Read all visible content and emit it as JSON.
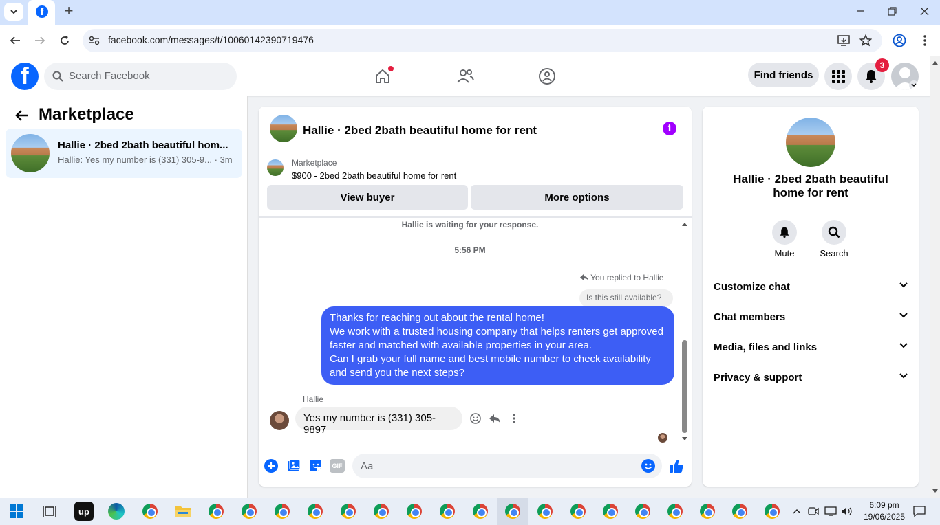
{
  "browser": {
    "url": "facebook.com/messages/t/10060142390719476",
    "new_tab_symbol": "+"
  },
  "header": {
    "search_placeholder": "Search Facebook",
    "find_friends": "Find friends",
    "notification_count": "3"
  },
  "left": {
    "title": "Marketplace",
    "conversation": {
      "title": "Hallie · 2bed 2bath beautiful hom...",
      "preview": "Hallie: Yes my number is (331) 305-9...",
      "time": "· 3m"
    }
  },
  "chat": {
    "title": "Hallie · 2bed 2bath beautiful home for rent",
    "listing_source": "Marketplace",
    "listing": "$900 - 2bed 2bath beautiful home for rent",
    "view_buyer": "View buyer",
    "more_options": "More options",
    "waiting": "Hallie is waiting for your response.",
    "timestamp": "5:56 PM",
    "replied_to": "You replied to Hallie",
    "quoted": "Is this still available?",
    "outgoing_lines": [
      "Thanks for reaching out about the rental home!",
      "We work with a trusted housing company that helps renters get approved",
      "faster and matched with available properties in your area.",
      "Can I grab your full name and best mobile number to check availability",
      "and send you the next steps?"
    ],
    "sender_name": "Hallie",
    "incoming": "Yes my number is (331) 305-9897",
    "input_placeholder": "Aa",
    "gif_label": "GIF"
  },
  "right": {
    "name": "Hallie · 2bed 2bath beautiful home for rent",
    "mute": "Mute",
    "search": "Search",
    "sections": [
      "Customize chat",
      "Chat members",
      "Media, files and links",
      "Privacy & support"
    ]
  },
  "taskbar": {
    "time": "6:09 pm",
    "date": "19/06/2025",
    "upwork": "up"
  },
  "colors": {
    "brand": "#0866ff",
    "outgoing_bubble": "#3d5ef5",
    "info_icon": "#a100ff",
    "badge": "#e41e3f"
  }
}
